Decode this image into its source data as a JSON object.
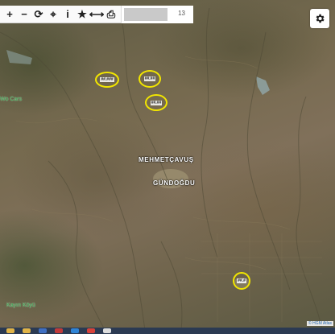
{
  "toolbar": {
    "tools": [
      {
        "icon": "plus-icon",
        "glyph": "+"
      },
      {
        "icon": "minus-icon",
        "glyph": "−"
      },
      {
        "icon": "refresh-icon",
        "glyph": "⟳"
      },
      {
        "icon": "crosshair-icon",
        "glyph": "⌖"
      },
      {
        "icon": "info-icon",
        "glyph": "i"
      },
      {
        "icon": "star-icon",
        "glyph": "★"
      },
      {
        "icon": "measure-icon",
        "glyph": "⟷"
      },
      {
        "icon": "print-icon",
        "glyph": "⎙"
      }
    ],
    "zoom_level": "13"
  },
  "settings": {
    "icon": "gear-icon"
  },
  "places": {
    "mehmetcavus": "MEHMETÇAVUŞ",
    "gundogdu": "GÜNDOĞDU"
  },
  "markers": [
    {
      "label": "##.###"
    },
    {
      "label": "##.##"
    },
    {
      "label": "##.##"
    },
    {
      "label": "##.#"
    }
  ],
  "side_labels": {
    "left_top": "Wo Cars",
    "left_bottom": "Kayın Köyü"
  },
  "attribution": "© HGM Atlas",
  "colors": {
    "marker_ring": "#f2e600",
    "toolbar_bg": "#fafafa",
    "taskbar_bg": "#2b3a52"
  }
}
